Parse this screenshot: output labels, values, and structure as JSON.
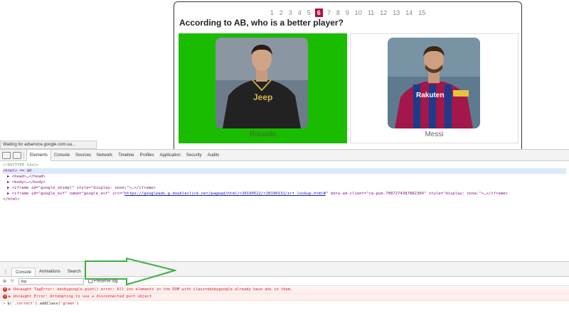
{
  "quiz": {
    "pages": [
      "1",
      "2",
      "3",
      "4",
      "5",
      "6",
      "7",
      "8",
      "9",
      "10",
      "11",
      "12",
      "13",
      "14",
      "15"
    ],
    "active_page": "6",
    "question": "According to AB, who is a better player?",
    "options": [
      {
        "label": "Ronaldo",
        "state": "correct"
      },
      {
        "label": "Messi",
        "state": "plain"
      }
    ]
  },
  "status_bar": "Waiting for adservice.google.com.ua...",
  "devtools": {
    "tabs": [
      "Elements",
      "Console",
      "Sources",
      "Network",
      "Timeline",
      "Profiles",
      "Application",
      "Security",
      "Audits"
    ],
    "active_tab": "Elements",
    "elements": {
      "doctype": "<!DOCTYPE html>",
      "html_line": "<html> == $0",
      "head": "<head>…</head>",
      "body": "<body>…</body>",
      "iframe1_start": "<iframe id=\"google_shimpl\" style=\"display: none;\">…</iframe>",
      "iframe2_start": "<iframe id=\"google_esf\" name=\"google_esf\" src=\"",
      "iframe2_url": "https://googleads.g.doubleclick.net/pagead/html/r20190522/r20190131/zrt_lookup.html#",
      "iframe2_end": "\" data-ad-client=\"ca-pub-7087274387882304\" style=\"display: none;\">…</iframe>",
      "html_close": "</html>"
    },
    "breadcrumb": "html",
    "console_tabs": [
      "Console",
      "Animations",
      "Search"
    ],
    "active_console_tab": "Console",
    "context": "top",
    "preserve_log": "Preserve log",
    "messages": [
      "Uncaught TagError: adsbygoogle.push() error: All ins elements in the DOM with class=adsbygoogle already have ads in them.",
      "Uncaught Error: Attempting to use a disconnected port object"
    ],
    "command": {
      "prefix": "$(",
      "selector": "'.correct'",
      "suffix": ").addClass(",
      "arg": "'green'",
      "end": ")"
    },
    "arrow_color": "#3cb043",
    "accent_color": "#b0103a",
    "correct_color": "#1abc00"
  }
}
